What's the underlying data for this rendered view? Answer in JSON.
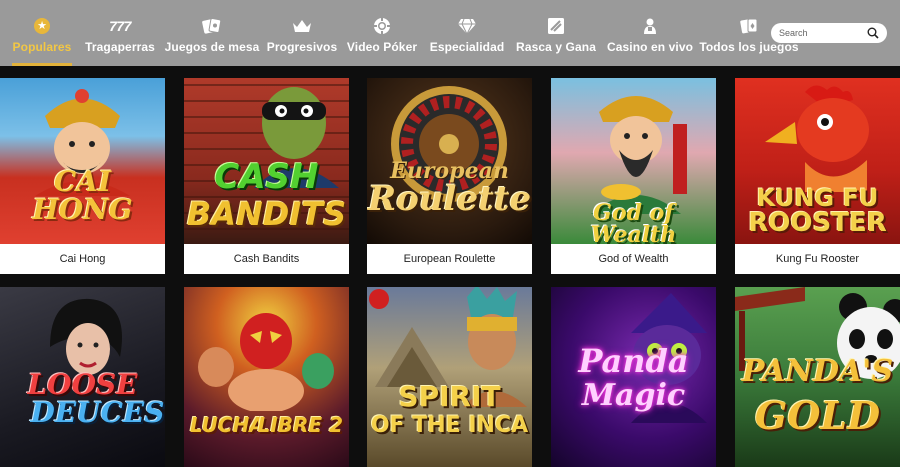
{
  "nav": {
    "items": [
      {
        "label": "Populares",
        "icon": "star-coin-icon",
        "active": true
      },
      {
        "label": "Tragaperras",
        "icon": "777-icon"
      },
      {
        "label": "Juegos de mesa",
        "icon": "cards-icon"
      },
      {
        "label": "Progresivos",
        "icon": "crown-icon"
      },
      {
        "label": "Video Póker",
        "icon": "chip-icon"
      },
      {
        "label": "Especialidad",
        "icon": "diamond-icon"
      },
      {
        "label": "Rasca y Gana",
        "icon": "scratch-icon"
      },
      {
        "label": "Casino en vivo",
        "icon": "dealer-icon"
      },
      {
        "label": "Todos los juegos",
        "icon": "cards-spread-icon"
      }
    ],
    "sevens_text": "777",
    "active_color": "#f2c744"
  },
  "search": {
    "placeholder": "Search"
  },
  "games": [
    {
      "caption": "Cai Hong",
      "logo_line1": "CAI",
      "logo_line2": "HONG"
    },
    {
      "caption": "Cash Bandits",
      "logo_line1": "CASH",
      "logo_line2": "BANDITS"
    },
    {
      "caption": "European Roulette",
      "logo_line1": "European",
      "logo_line2": "Roulette"
    },
    {
      "caption": "God of Wealth",
      "logo_line1": "God of Wealth",
      "logo_line2": ""
    },
    {
      "caption": "Kung Fu Rooster",
      "logo_line1": "KUNG FU",
      "logo_line2": "ROOSTER"
    },
    {
      "caption": "",
      "logo_line1": "LOOSE",
      "logo_line2": "DEUCES"
    },
    {
      "caption": "",
      "logo_line1": "LUCHA",
      "logo_line2": "LIBRE 2"
    },
    {
      "caption": "",
      "logo_line1": "SPIRIT",
      "logo_line2": "OF THE INCA"
    },
    {
      "caption": "",
      "logo_line1": "Panda",
      "logo_line2": "Magic"
    },
    {
      "caption": "",
      "logo_line1": "PANDA'S",
      "logo_line2": "GOLD"
    }
  ]
}
